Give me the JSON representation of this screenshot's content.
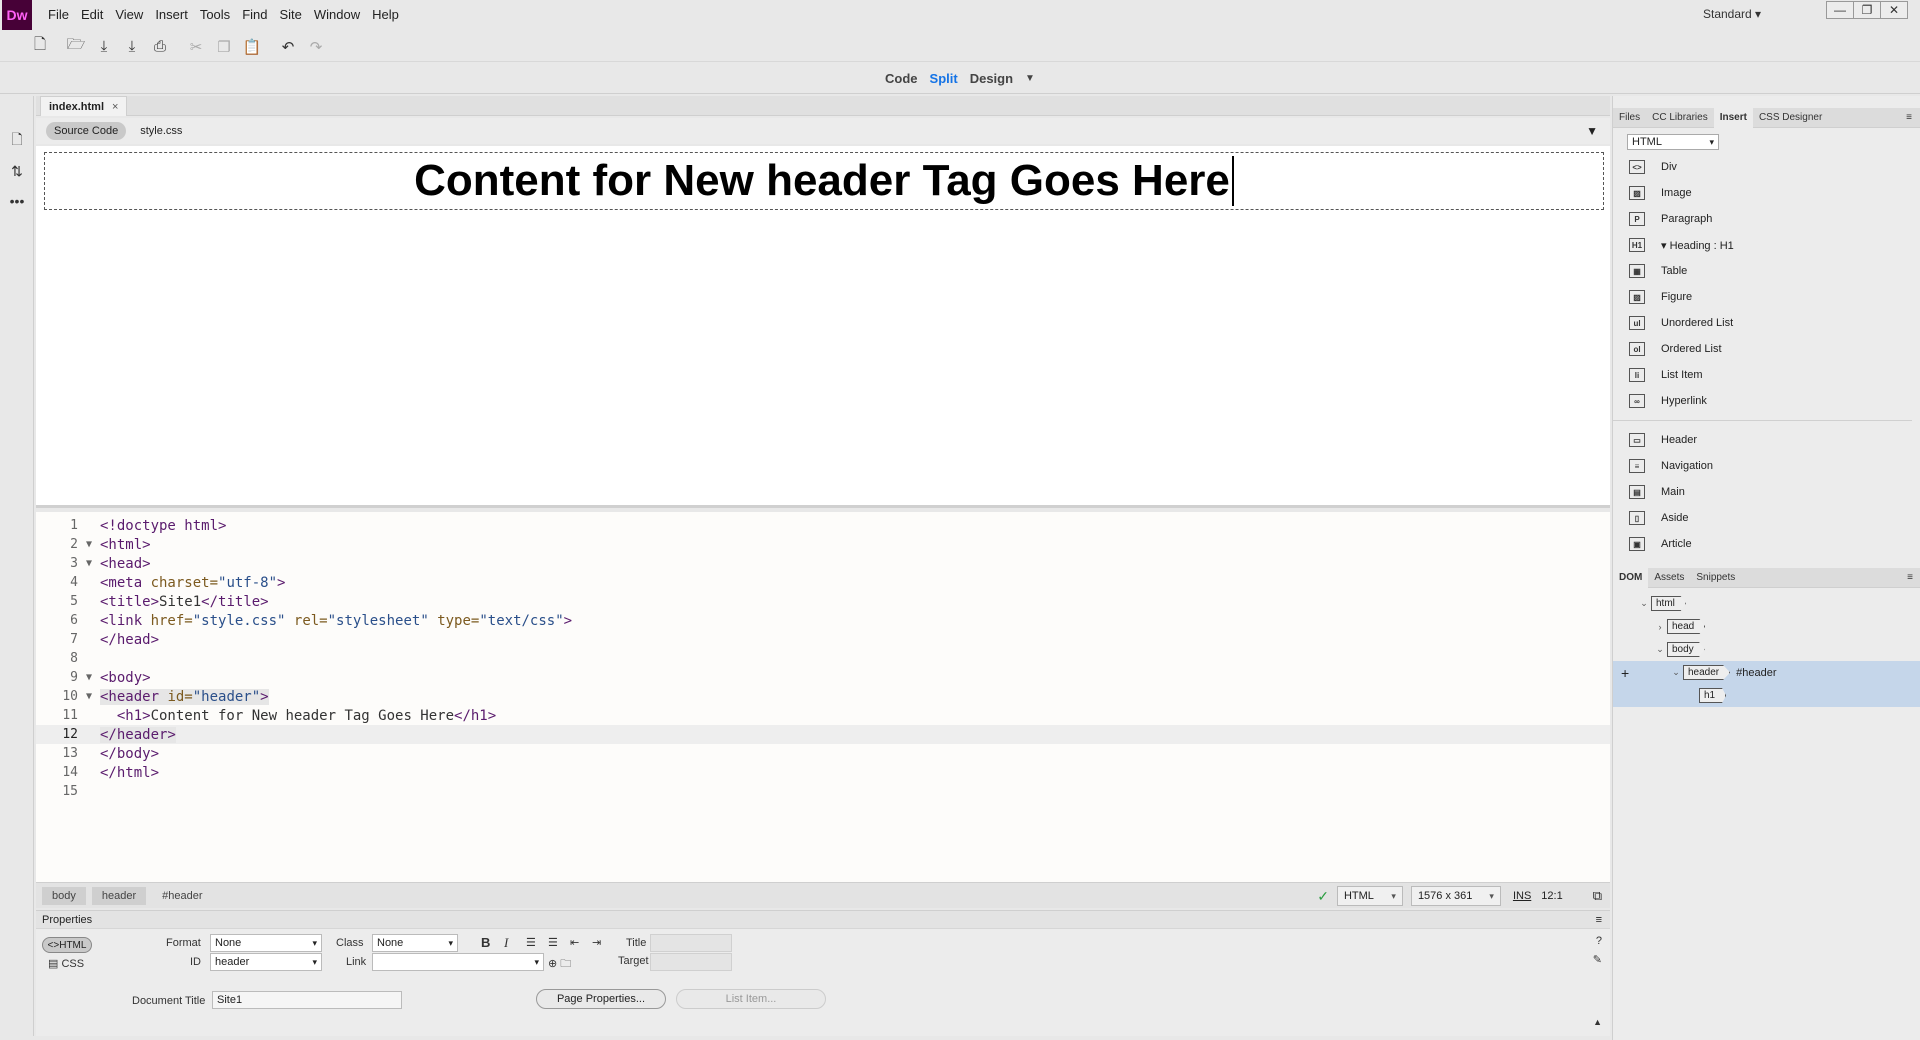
{
  "app": {
    "logo": "Dw",
    "workspace": "Standard"
  },
  "menu": [
    "File",
    "Edit",
    "View",
    "Insert",
    "Tools",
    "Find",
    "Site",
    "Window",
    "Help"
  ],
  "window_controls": {
    "minimize": "—",
    "restore": "❐",
    "close": "✕"
  },
  "toolbar_icons": [
    "new-file-icon",
    "open-icon",
    "save-icon",
    "save-all-icon",
    "print-icon",
    "cut-icon",
    "copy-icon",
    "paste-icon",
    "undo-icon",
    "redo-icon"
  ],
  "viewbar": {
    "code": "Code",
    "split": "Split",
    "design": "Design",
    "active": "Split"
  },
  "document": {
    "tab": "index.html",
    "close": "×",
    "source_code": "Source Code",
    "related_file": "style.css"
  },
  "design_view": {
    "header_text": "Content for New header Tag Goes Here"
  },
  "code_lines": [
    {
      "n": "1",
      "fold": "",
      "html": "<span class='tg'>&lt;!doctype html&gt;</span>"
    },
    {
      "n": "2",
      "fold": "▼",
      "html": "<span class='tg'>&lt;html&gt;</span>"
    },
    {
      "n": "3",
      "fold": "▼",
      "html": "<span class='tg'>&lt;head&gt;</span>"
    },
    {
      "n": "4",
      "fold": "",
      "html": "<span class='tg'>&lt;meta </span><span class='at'>charset=</span><span class='vl'>\"utf-8\"</span><span class='tg'>&gt;</span>"
    },
    {
      "n": "5",
      "fold": "",
      "html": "<span class='tg'>&lt;title&gt;</span><span class='tx'>Site1</span><span class='tg'>&lt;/title&gt;</span>"
    },
    {
      "n": "6",
      "fold": "",
      "html": "<span class='tg'>&lt;link </span><span class='at'>href=</span><span class='vl'>\"style.css\"</span> <span class='at'>rel=</span><span class='vl'>\"stylesheet\"</span> <span class='at'>type=</span><span class='vl'>\"text/css\"</span><span class='tg'>&gt;</span>"
    },
    {
      "n": "7",
      "fold": "",
      "html": "<span class='tg'>&lt;/head&gt;</span>"
    },
    {
      "n": "8",
      "fold": "",
      "html": ""
    },
    {
      "n": "9",
      "fold": "▼",
      "html": "<span class='tg'>&lt;body&gt;</span>"
    },
    {
      "n": "10",
      "fold": "▼",
      "html": "<span class='tg' style='background:#e6e6e6'>&lt;header </span><span class='at' style='background:#e6e6e6'>id=</span><span class='vl' style='background:#e6e6e6'>\"header\"</span><span class='tg' style='background:#e6e6e6'>&gt;</span>"
    },
    {
      "n": "11",
      "fold": "",
      "html": "  <span class='tg'>&lt;h1&gt;</span><span class='tx'>Content for New header Tag Goes Here</span><span class='tg'>&lt;/h1&gt;</span>"
    },
    {
      "n": "12",
      "fold": "",
      "html": "<span class='tg' style='background:#e6e6e6'>&lt;/header&gt;</span>",
      "current": true
    },
    {
      "n": "13",
      "fold": "",
      "html": "<span class='tg'>&lt;/body&gt;</span>"
    },
    {
      "n": "14",
      "fold": "",
      "html": "<span class='tg'>&lt;/html&gt;</span>"
    },
    {
      "n": "15",
      "fold": "",
      "html": ""
    }
  ],
  "statusbar": {
    "crumbs": [
      "body",
      "header",
      "#header"
    ],
    "mode": "HTML",
    "size": "1576 x 361",
    "ins": "INS",
    "pos": "12:1"
  },
  "properties": {
    "title": "Properties",
    "html_btn": "HTML",
    "css_btn": "CSS",
    "format_label": "Format",
    "format_value": "None",
    "class_label": "Class",
    "class_value": "None",
    "id_label": "ID",
    "id_value": "header",
    "link_label": "Link",
    "link_value": "",
    "title_label": "Title",
    "target_label": "Target",
    "doc_title_label": "Document Title",
    "doc_title_value": "Site1",
    "page_props": "Page Properties...",
    "list_item": "List Item..."
  },
  "panels": {
    "top_tabs": [
      "Files",
      "CC Libraries",
      "Insert",
      "CSS Designer"
    ],
    "active_top": "Insert",
    "insert_category": "HTML",
    "insert_items": [
      {
        "icon": "<>",
        "label": "Div"
      },
      {
        "icon": "▨",
        "label": "Image"
      },
      {
        "icon": "P",
        "label": "Paragraph"
      },
      {
        "icon": "H1",
        "label": "▾ Heading : H1"
      },
      {
        "icon": "▦",
        "label": "Table"
      },
      {
        "icon": "▨",
        "label": "Figure"
      },
      {
        "icon": "ul",
        "label": "Unordered List"
      },
      {
        "icon": "ol",
        "label": "Ordered List"
      },
      {
        "icon": "li",
        "label": "List Item"
      },
      {
        "icon": "∞",
        "label": "Hyperlink"
      }
    ],
    "insert_items2": [
      {
        "icon": "▭",
        "label": "Header"
      },
      {
        "icon": "≡",
        "label": "Navigation"
      },
      {
        "icon": "▤",
        "label": "Main"
      },
      {
        "icon": "▯",
        "label": "Aside"
      },
      {
        "icon": "▣",
        "label": "Article"
      }
    ],
    "bottom_tabs": [
      "DOM",
      "Assets",
      "Snippets"
    ],
    "active_bottom": "DOM",
    "dom": [
      {
        "tag": "html",
        "indent": 0,
        "tw": "⌄",
        "extra": ""
      },
      {
        "tag": "head",
        "indent": 1,
        "tw": "›",
        "extra": ""
      },
      {
        "tag": "body",
        "indent": 1,
        "tw": "⌄",
        "extra": ""
      },
      {
        "tag": "header",
        "indent": 2,
        "tw": "⌄",
        "extra": "#header",
        "selected": true
      },
      {
        "tag": "h1",
        "indent": 3,
        "tw": "",
        "extra": "",
        "selected": true
      }
    ]
  }
}
